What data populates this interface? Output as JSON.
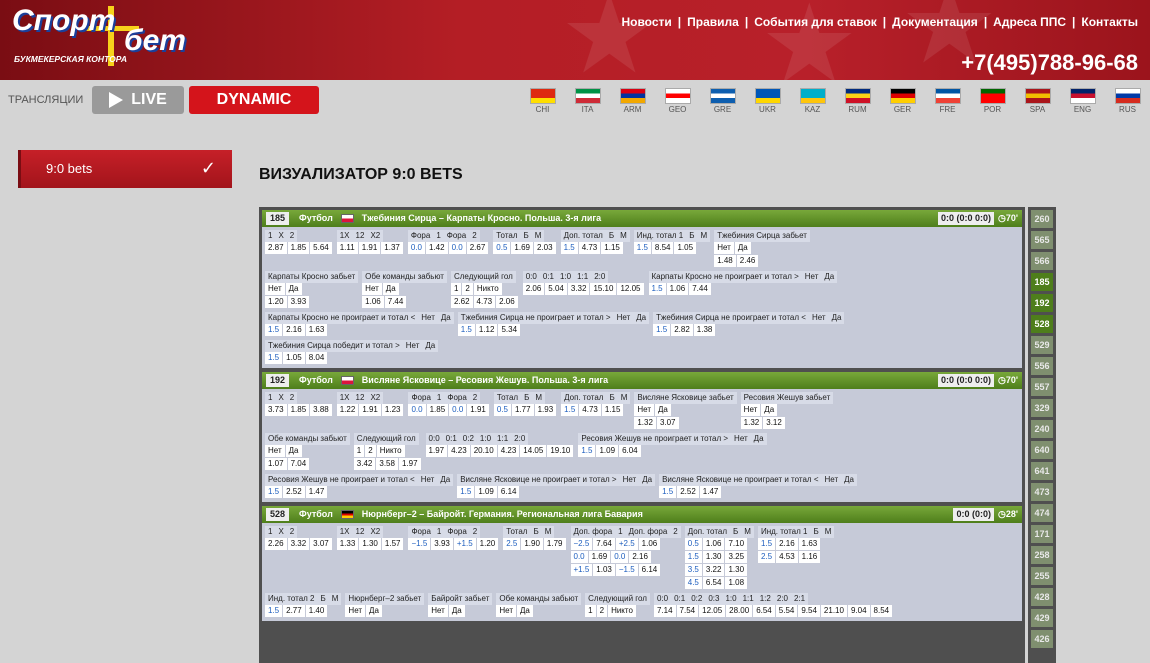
{
  "header": {
    "logo_word1": "Спорт",
    "logo_word2": "бет",
    "logo_sub": "БУКМЕКЕРСКАЯ КОНТОРА",
    "nav": [
      "Новости",
      "Правила",
      "События для ставок",
      "Документация",
      "Адреса ППС",
      "Контакты"
    ],
    "phone": "+7(495)788-96-68"
  },
  "toolbar": {
    "broadcast_label": "ТРАНСЛЯЦИИ",
    "live_label": "LIVE",
    "dynamic_label": "DYNAMIC"
  },
  "languages": [
    {
      "code": "CHI",
      "colors": [
        "#de2910",
        "#de2910",
        "#ffde00"
      ]
    },
    {
      "code": "ITA",
      "colors": [
        "#009246",
        "#ffffff",
        "#ce2b37"
      ]
    },
    {
      "code": "ARM",
      "colors": [
        "#d90012",
        "#0033a0",
        "#f2a800"
      ]
    },
    {
      "code": "GEO",
      "colors": [
        "#ffffff",
        "#ff0000",
        "#ffffff"
      ]
    },
    {
      "code": "GRE",
      "colors": [
        "#0d5eaf",
        "#ffffff",
        "#0d5eaf"
      ]
    },
    {
      "code": "UKR",
      "colors": [
        "#0057b7",
        "#0057b7",
        "#ffd700"
      ]
    },
    {
      "code": "KAZ",
      "colors": [
        "#00afca",
        "#00afca",
        "#fec50c"
      ]
    },
    {
      "code": "RUM",
      "colors": [
        "#002b7f",
        "#fcd116",
        "#ce1126"
      ]
    },
    {
      "code": "GER",
      "colors": [
        "#000000",
        "#dd0000",
        "#ffce00"
      ]
    },
    {
      "code": "FRE",
      "colors": [
        "#0055a4",
        "#ffffff",
        "#ef4135"
      ]
    },
    {
      "code": "POR",
      "colors": [
        "#006600",
        "#ff0000",
        "#ff0000"
      ]
    },
    {
      "code": "SPA",
      "colors": [
        "#aa151b",
        "#f1bf00",
        "#aa151b"
      ]
    },
    {
      "code": "ENG",
      "colors": [
        "#012169",
        "#c8102e",
        "#ffffff"
      ]
    },
    {
      "code": "RUS",
      "colors": [
        "#ffffff",
        "#0039a6",
        "#d52b1e"
      ]
    }
  ],
  "sidebar": {
    "item_label": "9:0 bets"
  },
  "page_title": "ВИЗУАЛИЗАТОР 9:0 BETS",
  "matches": [
    {
      "id": "185",
      "sport": "Футбол",
      "flag_colors": [
        "#ffffff",
        "#dc143c"
      ],
      "title": "Тжебиния Сирца – Карпаты Кросно.  Польша. 3-я лига",
      "score": "0:0 (0:0 0:0)",
      "time": "70'",
      "rows": [
        [
          {
            "h": [
              "1",
              "X",
              "2"
            ],
            "v": [
              [
                "2.87",
                "1.85",
                "5.64"
              ]
            ]
          },
          {
            "h": [
              "1X",
              "12",
              "X2"
            ],
            "v": [
              [
                "1.11",
                "1.91",
                "1.37"
              ]
            ]
          },
          {
            "h": [
              "Фора",
              "1",
              "Фора",
              "2"
            ],
            "v": [
              [
                "0.0",
                "1.42",
                "0.0",
                "2.67"
              ]
            ]
          },
          {
            "h": [
              "Тотал",
              "Б",
              "М"
            ],
            "v": [
              [
                "0.5",
                "1.69",
                "2.03"
              ]
            ]
          },
          {
            "h": [
              "Доп. тотал",
              "Б",
              "М"
            ],
            "v": [
              [
                "1.5",
                "4.73",
                "1.15"
              ]
            ]
          },
          {
            "h": [
              "Инд. тотал 1",
              "Б",
              "М"
            ],
            "v": [
              [
                "1.5",
                "8.54",
                "1.05"
              ]
            ]
          },
          {
            "h": [
              "Тжебиния Сирца забьет"
            ],
            "v": [
              [
                "Нет",
                "Да"
              ],
              [
                "1.48",
                "2.46"
              ]
            ]
          }
        ],
        [
          {
            "h": [
              "Карпаты Кросно забьет"
            ],
            "v": [
              [
                "Нет",
                "Да"
              ],
              [
                "1.20",
                "3.93"
              ]
            ]
          },
          {
            "h": [
              "Обе команды забьют"
            ],
            "v": [
              [
                "Нет",
                "Да"
              ],
              [
                "1.06",
                "7.44"
              ]
            ]
          },
          {
            "h": [
              "Следующий гол"
            ],
            "v": [
              [
                "1",
                "2",
                "Никто"
              ],
              [
                "2.62",
                "4.73",
                "2.06"
              ]
            ]
          },
          {
            "h": [
              "0:0",
              "0:1",
              "1:0",
              "1:1",
              "2:0"
            ],
            "v": [
              [
                "2.06",
                "5.04",
                "3.32",
                "15.10",
                "12.05"
              ]
            ]
          },
          {
            "h": [
              "Карпаты Кросно не проиграет и тотал >",
              "Нет",
              "Да"
            ],
            "v": [
              [
                "1.5",
                "1.06",
                "7.44"
              ]
            ]
          }
        ],
        [
          {
            "h": [
              "Карпаты Кросно не проиграет и тотал <",
              "Нет",
              "Да"
            ],
            "v": [
              [
                "1.5",
                "2.16",
                "1.63"
              ]
            ]
          },
          {
            "h": [
              "Тжебиния Сирца не проиграет и тотал >",
              "Нет",
              "Да"
            ],
            "v": [
              [
                "1.5",
                "1.12",
                "5.34"
              ]
            ]
          },
          {
            "h": [
              "Тжебиния Сирца не проиграет и тотал <",
              "Нет",
              "Да"
            ],
            "v": [
              [
                "1.5",
                "2.82",
                "1.38"
              ]
            ]
          }
        ],
        [
          {
            "h": [
              "Тжебиния Сирца победит и тотал >",
              "Нет",
              "Да"
            ],
            "v": [
              [
                "1.5",
                "1.05",
                "8.04"
              ]
            ]
          }
        ]
      ]
    },
    {
      "id": "192",
      "sport": "Футбол",
      "flag_colors": [
        "#ffffff",
        "#dc143c"
      ],
      "title": "Висляне Ясковице – Ресовия Жешув.  Польша. 3-я лига",
      "score": "0:0 (0:0 0:0)",
      "time": "70'",
      "rows": [
        [
          {
            "h": [
              "1",
              "X",
              "2"
            ],
            "v": [
              [
                "3.73",
                "1.85",
                "3.88"
              ]
            ]
          },
          {
            "h": [
              "1X",
              "12",
              "X2"
            ],
            "v": [
              [
                "1.22",
                "1.91",
                "1.23"
              ]
            ]
          },
          {
            "h": [
              "Фора",
              "1",
              "Фора",
              "2"
            ],
            "v": [
              [
                "0.0",
                "1.85",
                "0.0",
                "1.91"
              ]
            ]
          },
          {
            "h": [
              "Тотал",
              "Б",
              "М"
            ],
            "v": [
              [
                "0.5",
                "1.77",
                "1.93"
              ]
            ]
          },
          {
            "h": [
              "Доп. тотал",
              "Б",
              "М"
            ],
            "v": [
              [
                "1.5",
                "4.73",
                "1.15"
              ]
            ]
          },
          {
            "h": [
              "Висляне Ясковице забьет"
            ],
            "v": [
              [
                "Нет",
                "Да"
              ],
              [
                "1.32",
                "3.07"
              ]
            ]
          },
          {
            "h": [
              "Ресовия Жешув забьет"
            ],
            "v": [
              [
                "Нет",
                "Да"
              ],
              [
                "1.32",
                "3.12"
              ]
            ]
          }
        ],
        [
          {
            "h": [
              "Обе команды забьют"
            ],
            "v": [
              [
                "Нет",
                "Да"
              ],
              [
                "1.07",
                "7.04"
              ]
            ]
          },
          {
            "h": [
              "Следующий гол"
            ],
            "v": [
              [
                "1",
                "2",
                "Никто"
              ],
              [
                "3.42",
                "3.58",
                "1.97"
              ]
            ]
          },
          {
            "h": [
              "0:0",
              "0:1",
              "0:2",
              "1:0",
              "1:1",
              "2:0"
            ],
            "v": [
              [
                "1.97",
                "4.23",
                "20.10",
                "4.23",
                "14.05",
                "19.10"
              ]
            ]
          },
          {
            "h": [
              "Ресовия Жешув не проиграет и тотал >",
              "Нет",
              "Да"
            ],
            "v": [
              [
                "1.5",
                "1.09",
                "6.04"
              ]
            ]
          }
        ],
        [
          {
            "h": [
              "Ресовия Жешув не проиграет и тотал <",
              "Нет",
              "Да"
            ],
            "v": [
              [
                "1.5",
                "2.52",
                "1.47"
              ]
            ]
          },
          {
            "h": [
              "Висляне Ясковице не проиграет и тотал >",
              "Нет",
              "Да"
            ],
            "v": [
              [
                "1.5",
                "1.09",
                "6.14"
              ]
            ]
          },
          {
            "h": [
              "Висляне Ясковице не проиграет и тотал <",
              "Нет",
              "Да"
            ],
            "v": [
              [
                "1.5",
                "2.52",
                "1.47"
              ]
            ]
          }
        ]
      ]
    },
    {
      "id": "528",
      "sport": "Футбол",
      "flag_colors": [
        "#000000",
        "#dd0000",
        "#ffce00"
      ],
      "title": "Нюрнберг–2 – Байройт.  Германия. Региональная лига Бавария",
      "score": "0:0 (0:0)",
      "time": "28'",
      "rows": [
        [
          {
            "h": [
              "1",
              "X",
              "2"
            ],
            "v": [
              [
                "2.26",
                "3.32",
                "3.07"
              ]
            ]
          },
          {
            "h": [
              "1X",
              "12",
              "X2"
            ],
            "v": [
              [
                "1.33",
                "1.30",
                "1.57"
              ]
            ]
          },
          {
            "h": [
              "Фора",
              "1",
              "Фора",
              "2"
            ],
            "v": [
              [
                "−1.5",
                "3.93",
                "+1.5",
                "1.20"
              ]
            ]
          },
          {
            "h": [
              "Тотал",
              "Б",
              "М"
            ],
            "v": [
              [
                "2.5",
                "1.90",
                "1.79"
              ]
            ]
          },
          {
            "h": [
              "Доп. фора",
              "1",
              "Доп. фора",
              "2"
            ],
            "v": [
              [
                "−2.5",
                "7.64",
                "+2.5",
                "1.06"
              ],
              [
                "0.0",
                "1.69",
                "0.0",
                "2.16"
              ],
              [
                "+1.5",
                "1.03",
                "−1.5",
                "6.14"
              ]
            ]
          },
          {
            "h": [
              "Доп. тотал",
              "Б",
              "М"
            ],
            "v": [
              [
                "0.5",
                "1.06",
                "7.10"
              ],
              [
                "1.5",
                "1.30",
                "3.25"
              ],
              [
                "3.5",
                "3.22",
                "1.30"
              ],
              [
                "4.5",
                "6.54",
                "1.08"
              ]
            ]
          },
          {
            "h": [
              "Инд. тотал 1",
              "Б",
              "М"
            ],
            "v": [
              [
                "1.5",
                "2.16",
                "1.63"
              ],
              [
                "2.5",
                "4.53",
                "1.16"
              ]
            ]
          }
        ],
        [
          {
            "h": [
              "Инд. тотал 2",
              "Б",
              "М"
            ],
            "v": [
              [
                "1.5",
                "2.77",
                "1.40"
              ]
            ]
          },
          {
            "h": [
              "Нюрнберг–2 забьет"
            ],
            "v": [
              [
                "Нет",
                "Да"
              ]
            ]
          },
          {
            "h": [
              "Байройт забьет"
            ],
            "v": [
              [
                "Нет",
                "Да"
              ]
            ]
          },
          {
            "h": [
              "Обе команды забьют"
            ],
            "v": [
              [
                "Нет",
                "Да"
              ]
            ]
          },
          {
            "h": [
              "Следующий гол"
            ],
            "v": [
              [
                "1",
                "2",
                "Никто"
              ]
            ]
          },
          {
            "h": [
              "0:0",
              "0:1",
              "0:2",
              "0:3",
              "1:0",
              "1:1",
              "1:2",
              "2:0",
              "2:1"
            ],
            "v": [
              [
                "7.14",
                "7.54",
                "12.05",
                "28.00",
                "6.54",
                "5.54",
                "9.54",
                "21.10",
                "9.04",
                "8.54"
              ]
            ]
          }
        ]
      ]
    }
  ],
  "event_numbers": [
    {
      "n": "260",
      "hi": false
    },
    {
      "n": "565",
      "hi": false
    },
    {
      "n": "566",
      "hi": false
    },
    {
      "n": "185",
      "hi": true
    },
    {
      "n": "192",
      "hi": true
    },
    {
      "n": "528",
      "hi": true
    },
    {
      "n": "529",
      "hi": false
    },
    {
      "n": "556",
      "hi": false
    },
    {
      "n": "557",
      "hi": false
    },
    {
      "n": "329",
      "hi": false
    },
    {
      "n": "240",
      "hi": false
    },
    {
      "n": "640",
      "hi": false
    },
    {
      "n": "641",
      "hi": false
    },
    {
      "n": "473",
      "hi": false
    },
    {
      "n": "474",
      "hi": false
    },
    {
      "n": "171",
      "hi": false
    },
    {
      "n": "258",
      "hi": false
    },
    {
      "n": "255",
      "hi": false
    },
    {
      "n": "428",
      "hi": false
    },
    {
      "n": "429",
      "hi": false
    },
    {
      "n": "426",
      "hi": false
    }
  ]
}
